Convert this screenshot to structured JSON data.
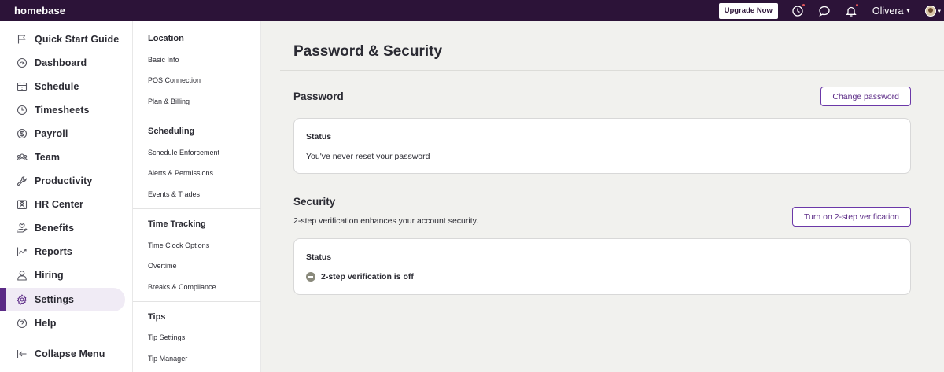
{
  "app": {
    "logo": "homebase"
  },
  "topbar": {
    "upgrade_label": "Upgrade Now",
    "user_name": "Olivera",
    "caret": "▾",
    "icons": [
      "clock-icon",
      "chat-icon",
      "bell-icon"
    ],
    "notification_dot_color": "#e0555a"
  },
  "sidebar": {
    "items": [
      {
        "label": "Quick Start Guide",
        "icon": "flag-icon"
      },
      {
        "label": "Dashboard",
        "icon": "gauge-icon"
      },
      {
        "label": "Schedule",
        "icon": "calendar-icon"
      },
      {
        "label": "Timesheets",
        "icon": "clock-icon"
      },
      {
        "label": "Payroll",
        "icon": "dollar-icon"
      },
      {
        "label": "Team",
        "icon": "team-icon"
      },
      {
        "label": "Productivity",
        "icon": "wrench-icon"
      },
      {
        "label": "HR Center",
        "icon": "id-card-icon"
      },
      {
        "label": "Benefits",
        "icon": "hand-icon"
      },
      {
        "label": "Reports",
        "icon": "chart-icon"
      },
      {
        "label": "Hiring",
        "icon": "person-icon"
      },
      {
        "label": "Settings",
        "icon": "gear-icon",
        "active": true
      },
      {
        "label": "Help",
        "icon": "question-icon"
      }
    ],
    "collapse_label": "Collapse Menu"
  },
  "subnav": {
    "groups": [
      {
        "heading": "Location",
        "items": [
          "Basic Info",
          "POS Connection",
          "Plan & Billing"
        ]
      },
      {
        "heading": "Scheduling",
        "items": [
          "Schedule Enforcement",
          "Alerts & Permissions",
          "Events & Trades"
        ]
      },
      {
        "heading": "Time Tracking",
        "items": [
          "Time Clock Options",
          "Overtime",
          "Breaks & Compliance"
        ]
      },
      {
        "heading": "Tips",
        "items": [
          "Tip Settings",
          "Tip Manager"
        ]
      }
    ]
  },
  "main": {
    "title": "Password & Security",
    "password": {
      "title": "Password",
      "button": "Change password",
      "status_label": "Status",
      "status_text": "You've never reset your password"
    },
    "security": {
      "title": "Security",
      "description": "2-step verification enhances your account security.",
      "button": "Turn on 2-step verification",
      "status_label": "Status",
      "status_text": "2-step verification is off"
    }
  },
  "colors": {
    "topbar": "#2c1338",
    "accent": "#5b2a86",
    "active_bg": "#f0ebf5",
    "page_bg": "#f1f1ee"
  }
}
